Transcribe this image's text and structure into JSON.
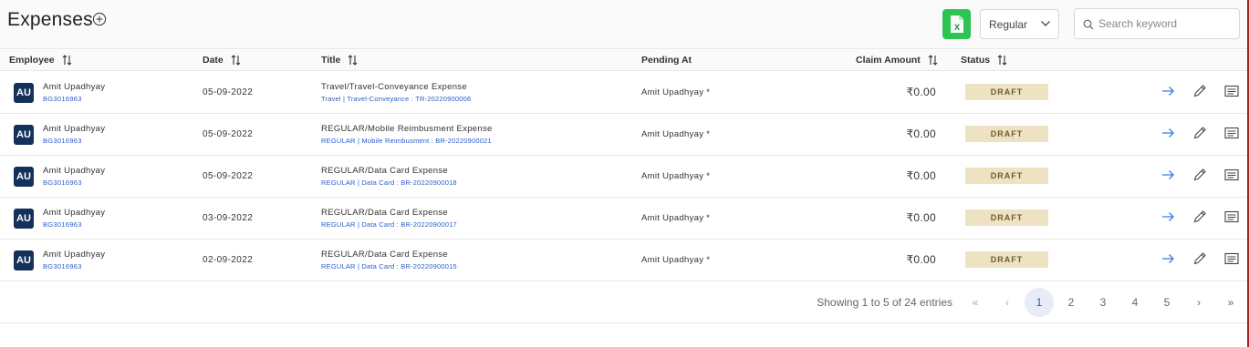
{
  "header": {
    "title": "Expenses",
    "excel_label": "X",
    "filter_value": "Regular",
    "search_placeholder": "Search keyword"
  },
  "columns": {
    "employee": "Employee",
    "date": "Date",
    "title": "Title",
    "pending_at": "Pending At",
    "claim_amount": "Claim Amount",
    "status": "Status"
  },
  "rows": [
    {
      "avatar": "AU",
      "name": "Amit Upadhyay",
      "emp_id": "BG3016963",
      "date": "05-09-2022",
      "title": "Travel/Travel-Conveyance Expense",
      "subtitle": "Travel | Travel-Conveyance : TR-20220900006",
      "pending_at": "Amit Upadhyay *",
      "amount": "₹0.00",
      "status": "DRAFT"
    },
    {
      "avatar": "AU",
      "name": "Amit Upadhyay",
      "emp_id": "BG3016963",
      "date": "05-09-2022",
      "title": "REGULAR/Mobile Reimbusment Expense",
      "subtitle": "REGULAR | Mobile Reimbusment : BR-20220900021",
      "pending_at": "Amit Upadhyay *",
      "amount": "₹0.00",
      "status": "DRAFT"
    },
    {
      "avatar": "AU",
      "name": "Amit Upadhyay",
      "emp_id": "BG3016963",
      "date": "05-09-2022",
      "title": "REGULAR/Data Card Expense",
      "subtitle": "REGULAR | Data Card : BR-20220900018",
      "pending_at": "Amit Upadhyay *",
      "amount": "₹0.00",
      "status": "DRAFT"
    },
    {
      "avatar": "AU",
      "name": "Amit Upadhyay",
      "emp_id": "BG3016963",
      "date": "03-09-2022",
      "title": "REGULAR/Data Card Expense",
      "subtitle": "REGULAR | Data Card : BR-20220900017",
      "pending_at": "Amit Upadhyay *",
      "amount": "₹0.00",
      "status": "DRAFT"
    },
    {
      "avatar": "AU",
      "name": "Amit Upadhyay",
      "emp_id": "BG3016963",
      "date": "02-09-2022",
      "title": "REGULAR/Data Card Expense",
      "subtitle": "REGULAR | Data Card : BR-20220900015",
      "pending_at": "Amit Upadhyay *",
      "amount": "₹0.00",
      "status": "DRAFT"
    }
  ],
  "pagination": {
    "showing": "Showing 1 to 5 of 24 entries",
    "first": "«",
    "prev": "‹",
    "pages": [
      "1",
      "2",
      "3",
      "4",
      "5"
    ],
    "next": "›",
    "last": "»",
    "active_page": "1"
  },
  "colors": {
    "avatar_bg": "#14315a",
    "excel_green": "#2ec452",
    "link_blue": "#2b5cc8",
    "status_draft_bg": "#ede3c2"
  },
  "icons": {
    "add": "plus-circle-icon",
    "excel": "excel-icon",
    "chevron": "chevron-down-icon",
    "search": "search-icon",
    "sort": "sort-icon",
    "view": "arrow-right-icon",
    "edit": "pencil-icon",
    "comments": "comment-icon"
  }
}
